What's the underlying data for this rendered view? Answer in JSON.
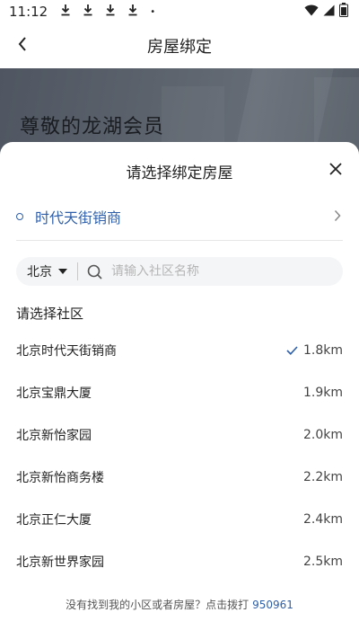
{
  "status_bar": {
    "time": "11:12",
    "dot": "•"
  },
  "nav": {
    "title": "房屋绑定"
  },
  "hero": {
    "greeting": "尊敬的龙湖会员"
  },
  "sheet": {
    "title": "请选择绑定房屋",
    "selected_property": "时代天街销商",
    "search": {
      "city": "北京",
      "placeholder": "请输入社区名称",
      "value": ""
    },
    "section_title": "请选择社区",
    "communities": [
      {
        "name": "北京时代天街销商",
        "distance": "1.8km",
        "selected": true
      },
      {
        "name": "北京宝鼎大厦",
        "distance": "1.9km",
        "selected": false
      },
      {
        "name": "北京新怡家园",
        "distance": "2.0km",
        "selected": false
      },
      {
        "name": "北京新怡商务楼",
        "distance": "2.2km",
        "selected": false
      },
      {
        "name": "北京正仁大厦",
        "distance": "2.4km",
        "selected": false
      },
      {
        "name": "北京新世界家园",
        "distance": "2.5km",
        "selected": false
      }
    ],
    "footer_text": "没有找到我的小区或者房屋？点击拨打",
    "footer_phone": "950961"
  },
  "colors": {
    "accent": "#2f5fa8",
    "hero_bg": "#5b626c",
    "overlay": "#1e2329"
  },
  "icons": [
    "download-icon",
    "wifi-icon",
    "battery-icon",
    "back-arrow-icon",
    "close-icon",
    "chevron-right-icon",
    "search-icon",
    "check-icon"
  ]
}
